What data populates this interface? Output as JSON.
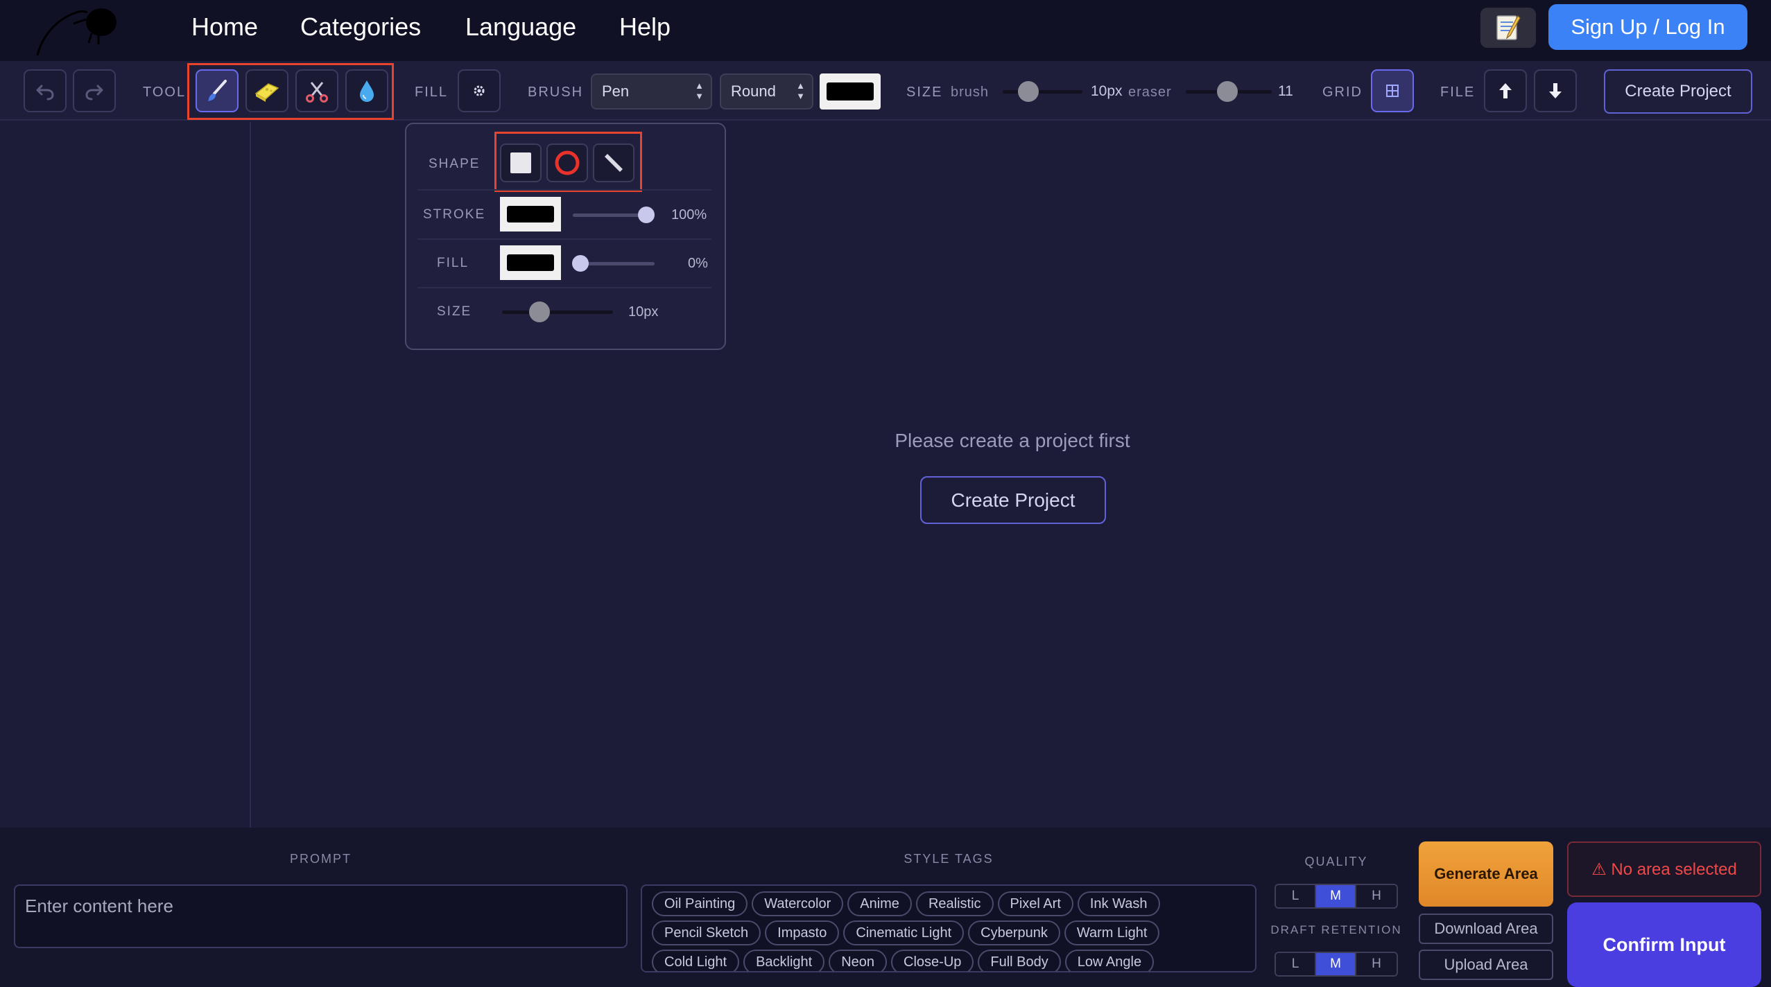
{
  "nav": {
    "links": [
      "Home",
      "Categories",
      "Language",
      "Help"
    ],
    "notes_icon": "memo-emoji",
    "signup_label": "Sign Up / Log In"
  },
  "toolbar": {
    "tool_label": "TOOL",
    "tools": [
      "brush",
      "eraser",
      "scissors",
      "droplet"
    ],
    "active_tool": "brush",
    "fill_label": "FILL",
    "brush_label": "BRUSH",
    "brush_type": "Pen",
    "brush_cap": "Round",
    "brush_color": "#000000",
    "size_label": "SIZE",
    "brush_small": "brush",
    "brush_size": "10px",
    "eraser_small": "eraser",
    "eraser_size": "11",
    "grid_label": "GRID",
    "file_label": "FILE",
    "create_label": "Create Project"
  },
  "popup": {
    "shape_label": "SHAPE",
    "shapes": [
      "square",
      "circle",
      "line"
    ],
    "stroke_label": "STROKE",
    "stroke_color": "#000000",
    "stroke_opacity": "100%",
    "fill_label": "FILL",
    "fill_color": "#000000",
    "fill_opacity": "0%",
    "size_label": "SIZE",
    "size_value": "10px"
  },
  "canvas": {
    "empty_message": "Please create a project first",
    "create_label": "Create Project"
  },
  "bottom": {
    "prompt_label": "PROMPT",
    "prompt_placeholder": "Enter content here",
    "style_label": "STYLE TAGS",
    "tags": [
      "Oil Painting",
      "Watercolor",
      "Anime",
      "Realistic",
      "Pixel Art",
      "Ink Wash",
      "Pencil Sketch",
      "Impasto",
      "Cinematic Light",
      "Cyberpunk",
      "Warm Light",
      "Cold Light",
      "Backlight",
      "Neon",
      "Close-Up",
      "Full Body",
      "Low Angle"
    ],
    "quality_label": "QUALITY",
    "quality_options": [
      "L",
      "M",
      "H"
    ],
    "quality_selected": "M",
    "draft_label": "DRAFT RETENTION",
    "draft_options": [
      "L",
      "M",
      "H"
    ],
    "draft_selected": "M",
    "generate_label": "Generate Area",
    "download_label": "Download Area",
    "upload_label": "Upload Area",
    "warning_text": "⚠ No area selected",
    "confirm_label": "Confirm Input"
  },
  "colors": {
    "background": "#1c1c38",
    "nav_bg": "#111126",
    "accent_blue": "#3b82f6",
    "accent_indigo": "#6262d8",
    "highlight_red": "#e8432c",
    "generate_orange": "#f0a23a",
    "confirm_purple": "#4b3ee0",
    "warning_red": "#f04848"
  }
}
